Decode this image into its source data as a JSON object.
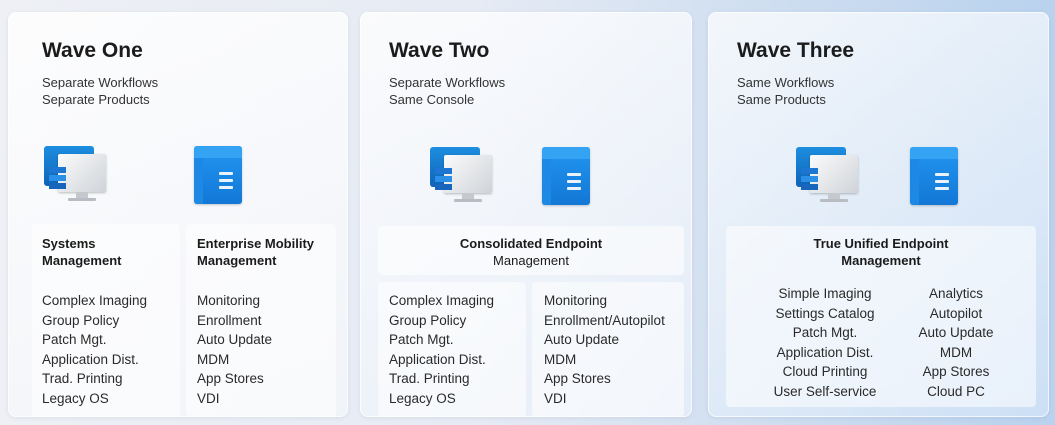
{
  "waves": [
    {
      "title": "Wave One",
      "subtitle": [
        "Separate Workflows",
        "Separate Products"
      ],
      "left_head": [
        "Systems",
        "Management"
      ],
      "right_head": [
        "Enterprise Mobility",
        "Management"
      ],
      "left_items": [
        "Complex Imaging",
        "Group Policy",
        "Patch Mgt.",
        "Application Dist.",
        "Trad. Printing",
        "Legacy OS"
      ],
      "right_items": [
        "Monitoring",
        "Enrollment",
        "Auto Update",
        "MDM",
        "App Stores",
        "VDI"
      ]
    },
    {
      "title": "Wave Two",
      "subtitle": [
        "Separate Workflows",
        "Same Console"
      ],
      "head": [
        "Consolidated Endpoint",
        "Management"
      ],
      "left_items": [
        "Complex Imaging",
        "Group Policy",
        "Patch Mgt.",
        "Application Dist.",
        "Trad. Printing",
        "Legacy OS"
      ],
      "right_items": [
        "Monitoring",
        "Enrollment/Autopilot",
        "Auto Update",
        "MDM",
        "App Stores",
        "VDI"
      ]
    },
    {
      "title": "Wave Three",
      "subtitle": [
        "Same Workflows",
        "Same Products"
      ],
      "head": [
        "True Unified Endpoint",
        "Management"
      ],
      "left_items": [
        "Simple Imaging",
        "Settings Catalog",
        "Patch Mgt.",
        "Application Dist.",
        "Cloud Printing",
        "User Self-service"
      ],
      "right_items": [
        "Analytics",
        "Autopilot",
        "Auto Update",
        "MDM",
        "App Stores",
        "Cloud PC"
      ]
    }
  ],
  "icons": [
    "desktop-monitor-icon",
    "app-window-icon"
  ]
}
